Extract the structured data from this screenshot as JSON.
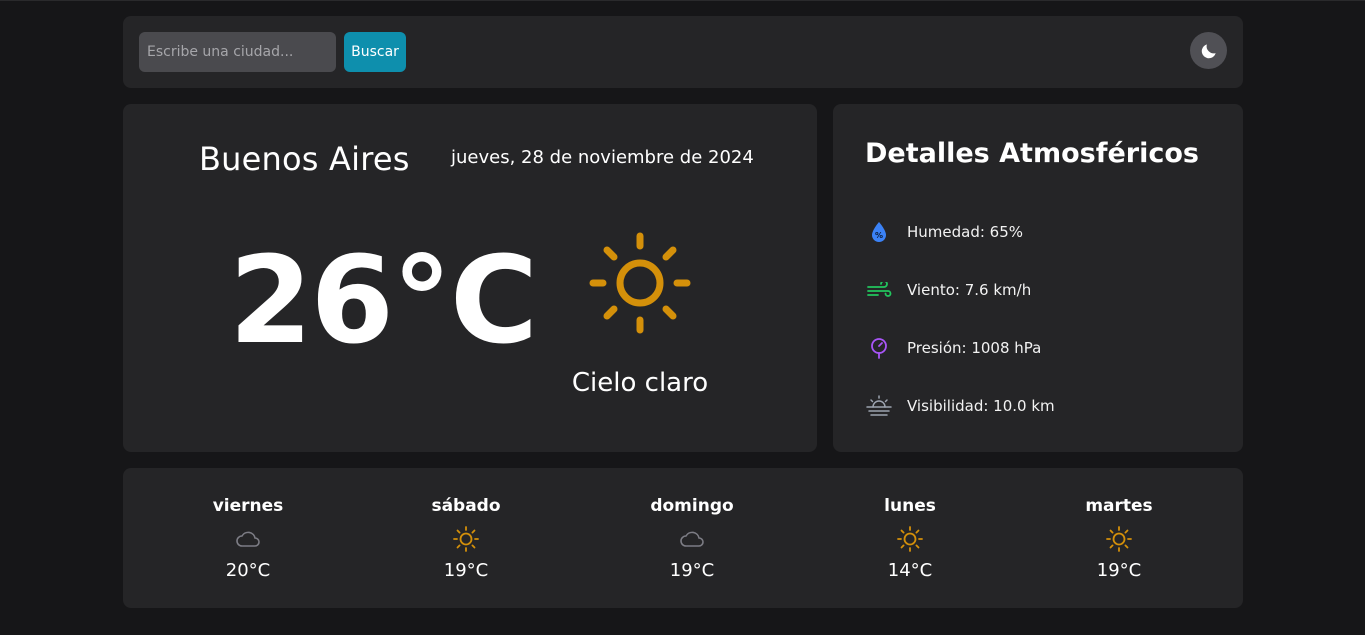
{
  "search": {
    "placeholder": "Escribe una ciudad...",
    "value": "",
    "button_label": "Buscar"
  },
  "theme_toggle": {
    "icon": "moon-icon"
  },
  "current": {
    "city": "Buenos Aires",
    "date": "jueves, 28 de noviembre de 2024",
    "temperature": "26°C",
    "condition": "Cielo claro",
    "condition_icon": "sun-icon"
  },
  "details": {
    "title": "Detalles Atmosféricos",
    "items": [
      {
        "icon": "humidity-drop-icon",
        "label": "Humedad: 65%",
        "color": "#3b82f6"
      },
      {
        "icon": "wind-icon",
        "label": "Viento: 7.6 km/h",
        "color": "#22c55e"
      },
      {
        "icon": "pressure-gauge-icon",
        "label": "Presión: 1008 hPa",
        "color": "#a855f7"
      },
      {
        "icon": "visibility-sun-haze-icon",
        "label": "Visibilidad: 10.0 km",
        "color": "#9ca3af"
      }
    ]
  },
  "forecast": [
    {
      "day": "viernes",
      "icon": "cloud-icon",
      "temp": "20°C"
    },
    {
      "day": "sábado",
      "icon": "sun-icon",
      "temp": "19°C"
    },
    {
      "day": "domingo",
      "icon": "cloud-icon",
      "temp": "19°C"
    },
    {
      "day": "lunes",
      "icon": "sun-icon",
      "temp": "14°C"
    },
    {
      "day": "martes",
      "icon": "sun-icon",
      "temp": "19°C"
    }
  ],
  "colors": {
    "background": "#161618",
    "card": "#252527",
    "accent": "#0e8fad",
    "sun": "#d4900a",
    "cloud": "#7d7d85"
  }
}
